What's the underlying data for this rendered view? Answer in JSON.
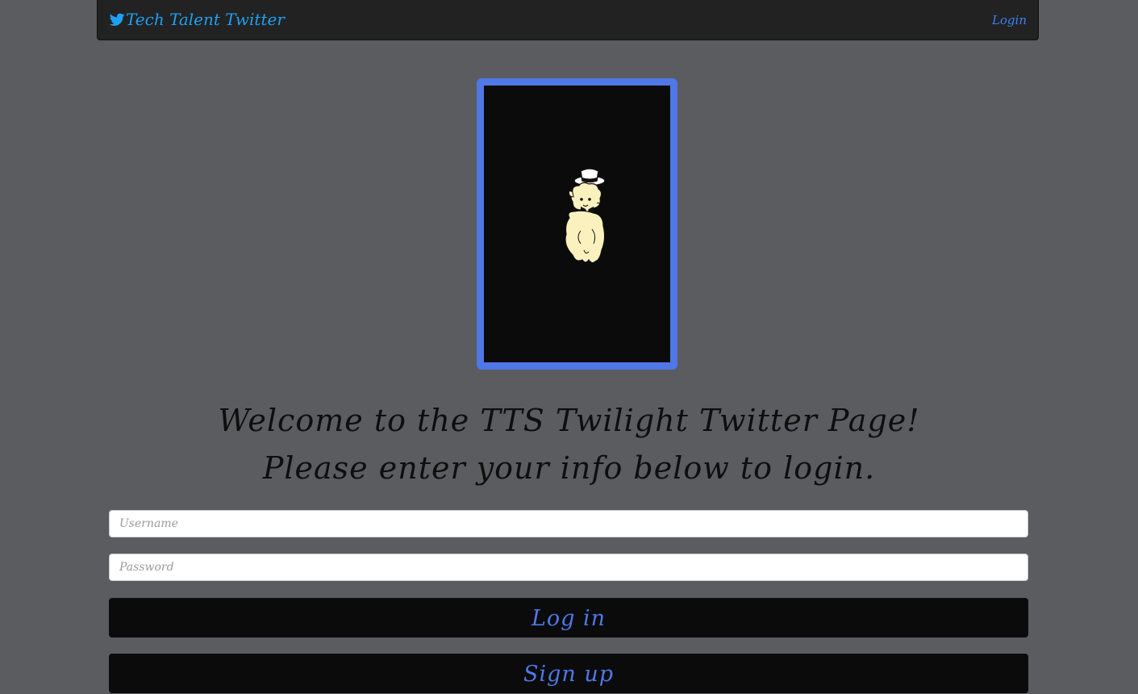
{
  "navbar": {
    "brand_icon": "twitter-bird-icon",
    "brand_label": "Tech Talent Twitter",
    "login_link": "Login"
  },
  "mascot": {
    "image": "alpaca-with-top-hat"
  },
  "welcome": {
    "line1": "Welcome to the TTS Twilight Twitter Page!",
    "line2": "Please enter your info below to login."
  },
  "form": {
    "username_placeholder": "Username",
    "username_value": "",
    "password_placeholder": "Password",
    "password_value": "",
    "login_button": "Log in",
    "signup_button": "Sign up"
  },
  "colors": {
    "background": "#5b5c60",
    "navbar": "#222222",
    "brand": "#1da1f2",
    "accent": "#4f77e6",
    "button_bg": "#0b0b0c"
  }
}
